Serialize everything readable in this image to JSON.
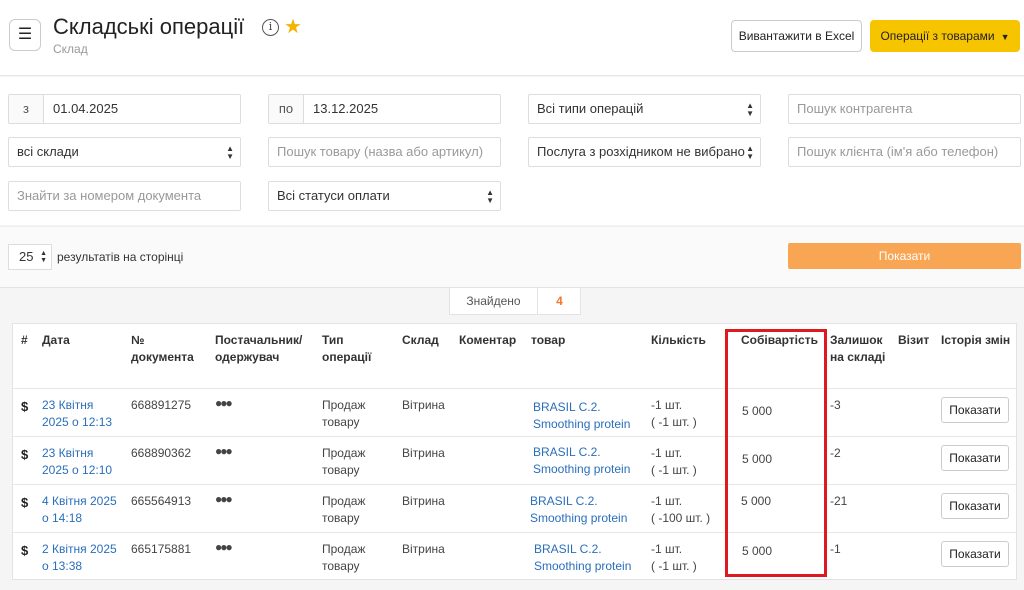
{
  "header": {
    "menu_icon": "hamburger-icon",
    "title": "Складські операції",
    "subtitle": "Склад",
    "info_icon": "info-icon",
    "star_icon": "star-icon",
    "excel_label": "Вивантажити в Excel",
    "ops_label": "Операції з товарами"
  },
  "filters": {
    "date_from_prefix": "з",
    "date_from": "01.04.2025",
    "date_to_prefix": "по",
    "date_to": "13.12.2025",
    "op_type": "Всі типи операцій",
    "contractor_placeholder": "Пошук контрагента",
    "warehouse": "всі склади",
    "product_placeholder": "Пошук товару (назва або артикул)",
    "service": "Послуга з розхідником не вибрано",
    "client_placeholder": "Пошук клієнта (ім'я або телефон)",
    "doc_placeholder": "Знайти за номером документа",
    "payment_status": "Всі статуси оплати"
  },
  "pager": {
    "per_page": "25",
    "per_page_label": "результатів на сторінці",
    "show_label": "Показати"
  },
  "found": {
    "label": "Знайдено",
    "count": "4"
  },
  "table": {
    "headers": {
      "hash": "#",
      "date": "Дата",
      "doc": "№ документа",
      "party": "Постачальник/ одержувач",
      "op_type": "Тип операції",
      "warehouse": "Склад",
      "comment": "Коментар",
      "product": "товар",
      "qty": "Кількість",
      "cost": "Собівартість",
      "stock": "Залишок на складі",
      "visit": "Візит",
      "history": "Історія змін"
    },
    "rows": [
      {
        "icon": "$",
        "date": "23 Квітня 2025 о 12:13",
        "doc": "668891275",
        "op_type": "Продаж товару",
        "warehouse": "Вітрина",
        "product": "BRASIL C.2. Smoothing protein",
        "qty1": "-1 шт.",
        "qty2": "( -1 шт. )",
        "cost": "5 000",
        "stock": "-3",
        "history_btn": "Показати"
      },
      {
        "icon": "$",
        "date": "23 Квітня 2025 о 12:10",
        "doc": "668890362",
        "op_type": "Продаж товару",
        "warehouse": "Вітрина",
        "product": "BRASIL C.2. Smoothing protein",
        "qty1": "-1 шт.",
        "qty2": "( -1 шт. )",
        "cost": "5 000",
        "stock": "-2",
        "history_btn": "Показати"
      },
      {
        "icon": "$",
        "date": "4 Квітня 2025 о 14:18",
        "doc": "665564913",
        "op_type": "Продаж товару",
        "warehouse": "Вітрина",
        "product": "BRASIL C.2. Smoothing protein",
        "qty1": "-1 шт.",
        "qty2": "( -100 шт. )",
        "cost": "5 000",
        "stock": "-21",
        "history_btn": "Показати"
      },
      {
        "icon": "$",
        "date": "2 Квітня 2025 о 13:38",
        "doc": "665175881",
        "op_type": "Продаж товару",
        "warehouse": "Вітрина",
        "product": "BRASIL C.2. Smoothing protein",
        "qty1": "-1 шт.",
        "qty2": "( -1 шт. )",
        "cost": "5 000",
        "stock": "-1",
        "history_btn": "Показати"
      }
    ]
  },
  "colors": {
    "accent": "#f7c400",
    "show_button": "#f8a653",
    "highlight": "#e0191e",
    "link": "#2a6ebb"
  }
}
